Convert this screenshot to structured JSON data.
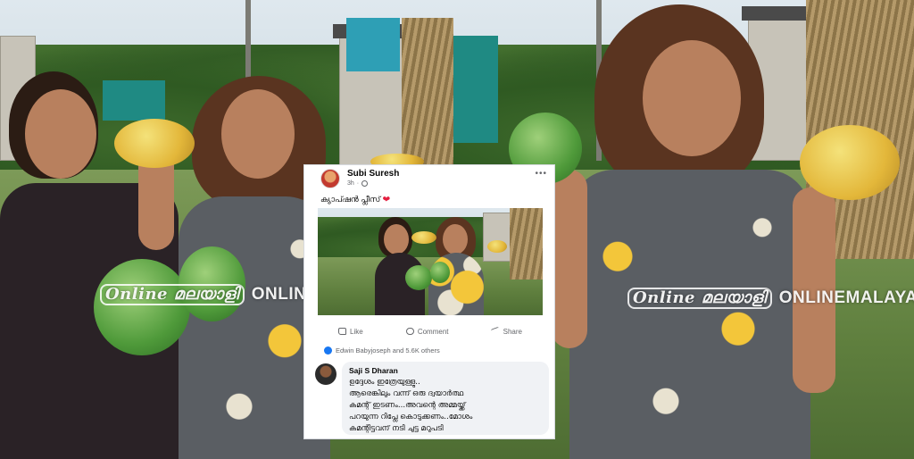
{
  "watermark": {
    "brand_text": "ONLINEMALAYALI",
    "logo_text": "Online മലയാളി"
  },
  "post": {
    "author": "Subi Suresh",
    "time": "3h",
    "caption": "ക്യാപ്ഷൻ പ്ലീസ്",
    "actions": {
      "like": "Like",
      "comment": "Comment",
      "share": "Share"
    },
    "reactions_text": "Edwin Babyjoseph and 5.6K others",
    "comment": {
      "author": "Saji S Dharan",
      "lines": [
        "ഉദ്ദേശം ഇത്രേയുള്ളു..",
        "ആരെങ്കിലും വന്ന് ഒരു ദ്വയാർത്ഥ",
        "കമന്റ് ഇടണം...അവന്റെ അമ്മയ്ക്ക്",
        "പറയുന്ന റിപ്ലേ കൊടുക്കണം..മോശം",
        "കമന്റിട്ടവന് നടി ചുട്ട മറുപടി"
      ]
    }
  },
  "colors": {
    "facebook_blue": "#1877f2",
    "heart_red": "#e41e3f",
    "comment_bg": "#f0f2f5"
  },
  "icons": [
    "globe-icon",
    "more-icon",
    "like-icon",
    "comment-icon",
    "share-icon",
    "heart-icon"
  ]
}
